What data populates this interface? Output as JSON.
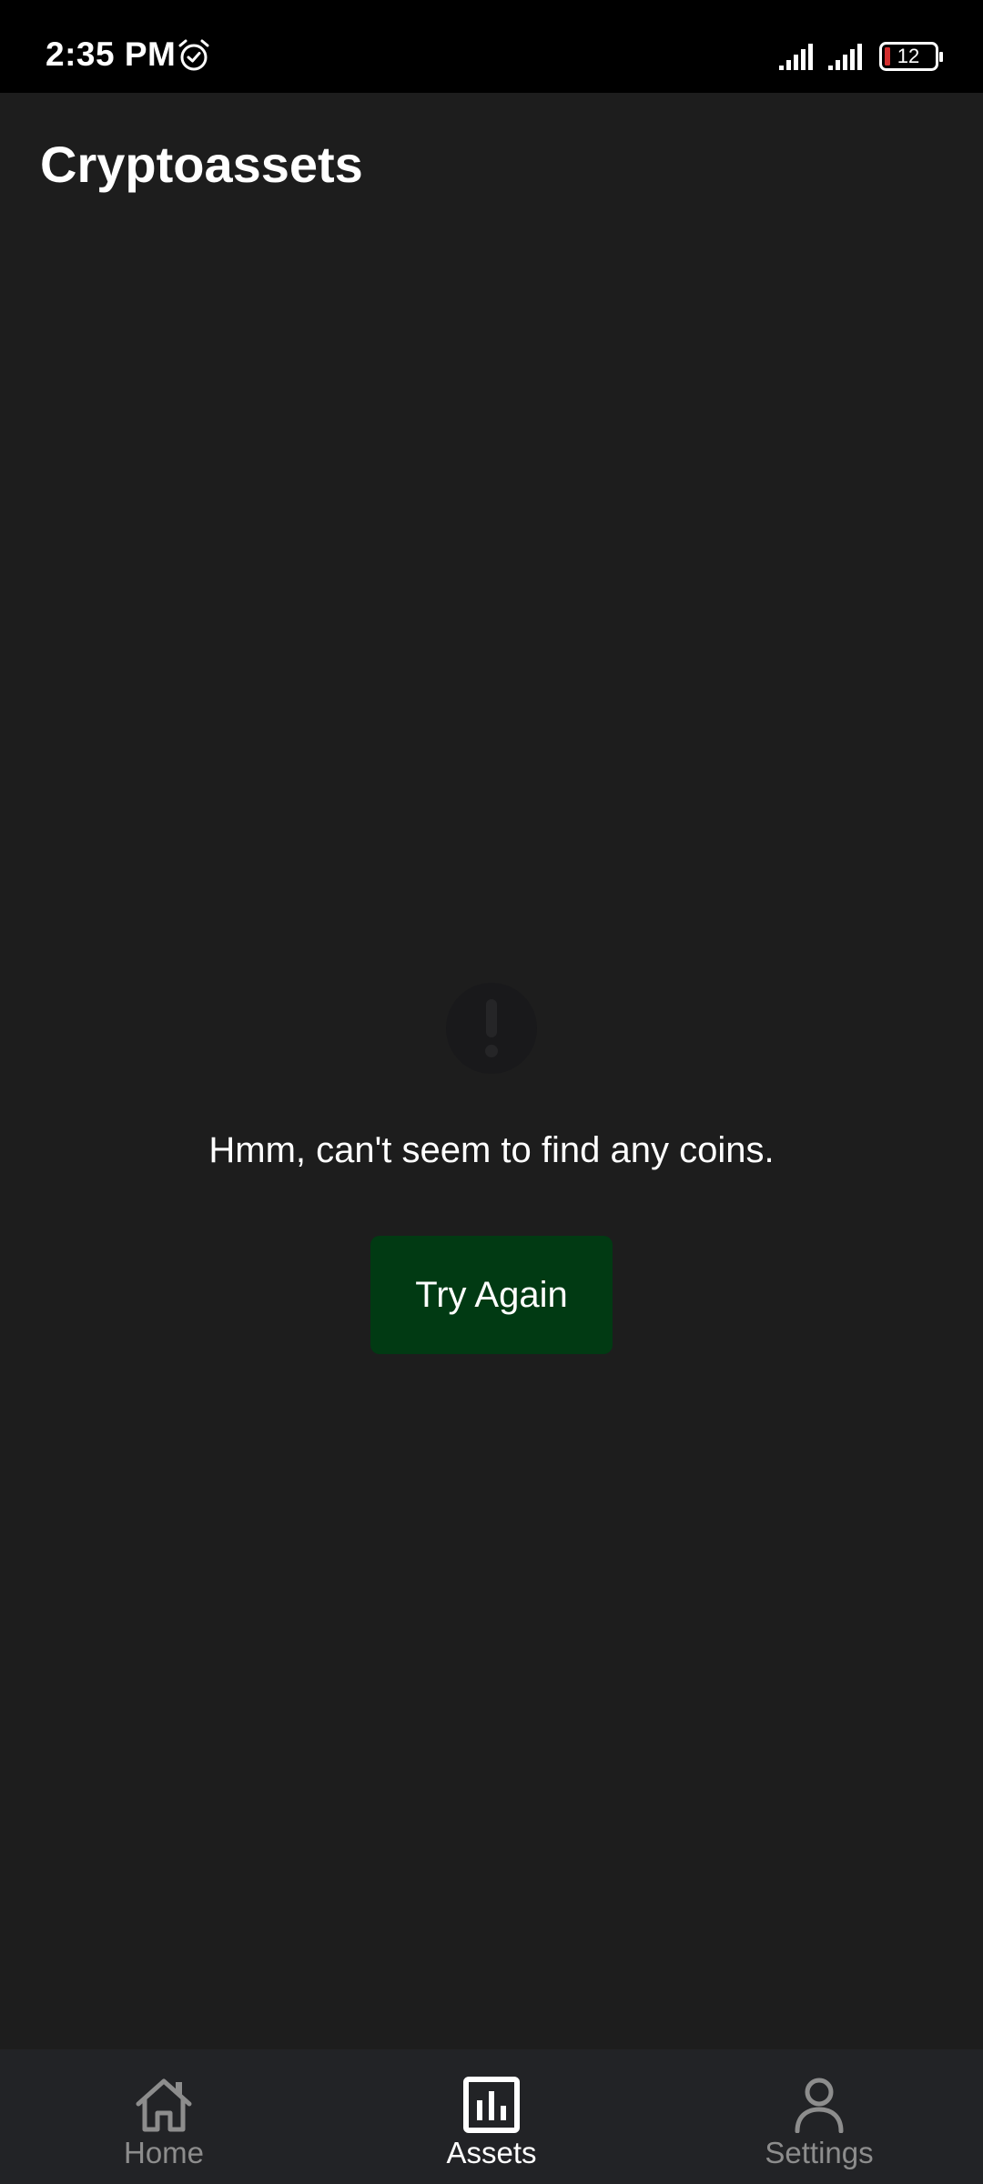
{
  "status_bar": {
    "time": "2:35 PM",
    "alarm_icon": "alarm-clock-icon",
    "signal_icons": [
      "signal-bars-icon",
      "signal-bars-icon"
    ],
    "battery_level": "12",
    "battery_color": "#d32f2f"
  },
  "header": {
    "title": "Cryptoassets"
  },
  "empty_state": {
    "icon": "exclamation-circle-icon",
    "message": "Hmm, can't seem to find any coins.",
    "button_label": "Try Again",
    "button_color": "#013a13"
  },
  "bottom_nav": {
    "items": [
      {
        "label": "Home",
        "icon": "home-icon",
        "active": false
      },
      {
        "label": "Assets",
        "icon": "bar-chart-icon",
        "active": true
      },
      {
        "label": "Settings",
        "icon": "person-icon",
        "active": false
      }
    ]
  },
  "colors": {
    "background": "#1d1d1d",
    "status_bar": "#000000",
    "nav_background": "#222326",
    "active_text": "#ffffff",
    "inactive_text": "#8d8d8d"
  }
}
